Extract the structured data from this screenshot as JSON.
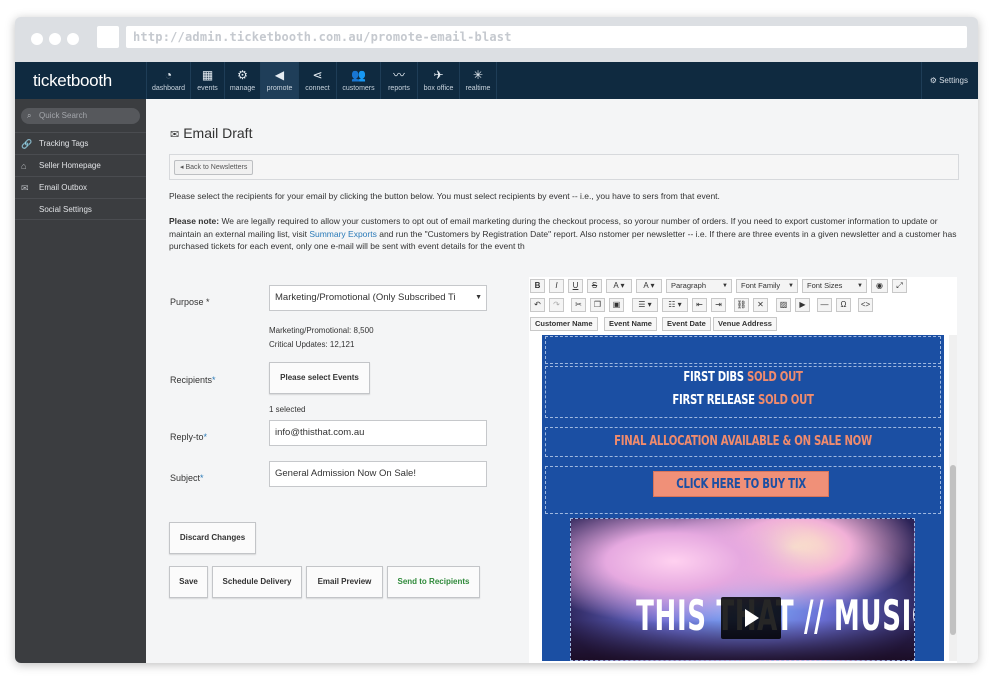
{
  "browser": {
    "url": "http://admin.ticketbooth.com.au/promote-email-blast"
  },
  "topnav": {
    "brand": "ticketbooth",
    "items": [
      {
        "label": "dashboard",
        "icon": "dashboard-icon"
      },
      {
        "label": "events",
        "icon": "calendar-icon"
      },
      {
        "label": "manage",
        "icon": "gear-icon"
      },
      {
        "label": "promote",
        "icon": "megaphone-icon",
        "active": true
      },
      {
        "label": "connect",
        "icon": "share-icon"
      },
      {
        "label": "customers",
        "icon": "users-icon"
      },
      {
        "label": "reports",
        "icon": "chart-icon"
      },
      {
        "label": "box office",
        "icon": "box-office-icon"
      },
      {
        "label": "realtime",
        "icon": "realtime-icon"
      }
    ],
    "settings_label": "Settings"
  },
  "sidebar": {
    "search_placeholder": "Quick Search",
    "items": [
      {
        "label": "Tracking Tags",
        "icon": "link-icon"
      },
      {
        "label": "Seller Homepage",
        "icon": "home-icon"
      },
      {
        "label": "Email Outbox",
        "icon": "envelope-icon"
      },
      {
        "label": "Social Settings",
        "icon": ""
      }
    ]
  },
  "main": {
    "title": "Email Draft",
    "back_label": "Back to Newsletters",
    "intro": "Please select the recipients for your email by clicking the button below. You must select recipients by event -- i.e., you have to sers from that event.",
    "note_bold": "Please note:",
    "note_text_1": " We are legally required to allow your customers to opt out of email marketing during the checkout process, so yorour number of orders. If you need to export customer information to update or maintain an external mailing list, visit ",
    "note_link": "Summary Exports",
    "note_text_2": " and run the \"Customers by Registration Date\" report. Also nstomer per newsletter -- i.e. If there are three events in a given newsletter and a customer has purchased tickets for each event, only one e-mail will be sent with event details for the event th"
  },
  "form": {
    "purpose_label": "Purpose *",
    "purpose_value": "Marketing/Promotional (Only Subscribed Ti",
    "marketing_stat_label": "Marketing/Promotional:",
    "marketing_stat_value": "8,500",
    "critical_stat_label": "Critical Updates:",
    "critical_stat_value": "12,121",
    "recipients_label": "Recipients",
    "select_events_label": "Please select Events",
    "selected_text": "1 selected",
    "reply_label": "Reply-to",
    "reply_value": "info@thisthat.com.au",
    "subject_label": "Subject",
    "subject_value": "General Admission Now On Sale!",
    "required_mark": "*"
  },
  "actions": {
    "discard": "Discard Changes",
    "save": "Save",
    "schedule": "Schedule Delivery",
    "preview": "Email Preview",
    "send": "Send to Recipients"
  },
  "editor": {
    "format_select": "Paragraph",
    "font_family_select": "Font Family",
    "font_size_select": "Font Sizes",
    "merge_tags": [
      "Customer Name",
      "Event Name",
      "Event Date",
      "Venue Address"
    ]
  },
  "email_preview": {
    "line1_a": "FIRST DIBS ",
    "line1_b": "SOLD OUT",
    "line2_a": "FIRST RELEASE ",
    "line2_b": "SOLD OUT",
    "final_allocation": "FINAL ALLOCATION AVAILABLE & ON SALE NOW",
    "cta": "CLICK HERE TO BUY TIX",
    "hero_title": "THIS THAT // MUSIC"
  },
  "colors": {
    "nav_bg": "#0f2a40",
    "sidebar_bg": "#3b3d40",
    "email_blue": "#1b4fa3",
    "email_accent": "#f08b6d",
    "link": "#2a7ab8",
    "send_green": "#2f8a3a"
  }
}
